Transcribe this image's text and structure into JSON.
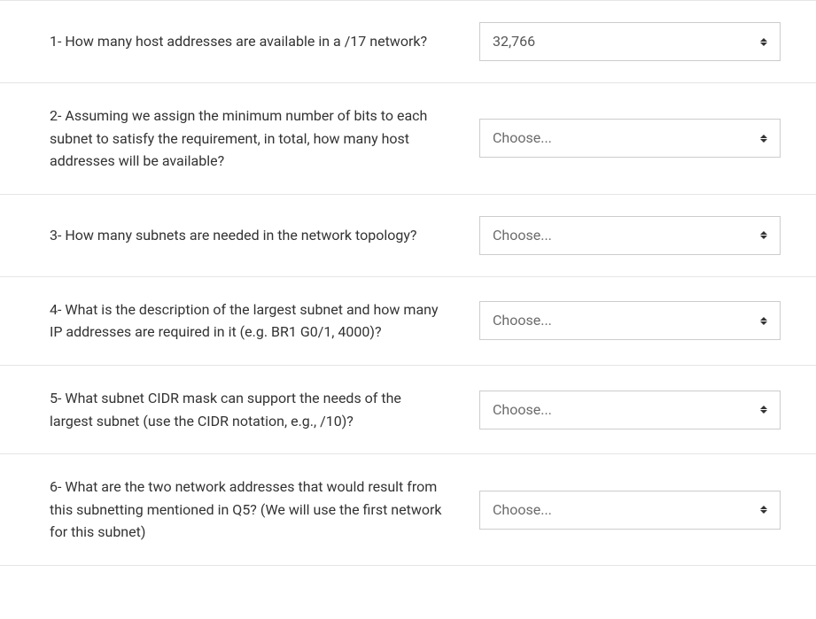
{
  "questions": [
    {
      "text": "1- How many host addresses are available in a /17 network?",
      "selected": "32,766",
      "isPlaceholder": false
    },
    {
      "text": "2- Assuming we assign the minimum number of bits to each subnet to satisfy the requirement, in total, how many host addresses will be available?",
      "selected": "Choose...",
      "isPlaceholder": true
    },
    {
      "text": "3- How many subnets are needed in the network topology?",
      "selected": "Choose...",
      "isPlaceholder": true
    },
    {
      "text": "4- What is the description of the largest subnet and how many IP addresses are required in it (e.g. BR1 G0/1, 4000)?",
      "selected": "Choose...",
      "isPlaceholder": true
    },
    {
      "text": "5- What subnet CIDR mask can support the needs of the largest subnet (use the CIDR notation, e.g., /10)?",
      "selected": "Choose...",
      "isPlaceholder": true
    },
    {
      "text": "6- What are the two network addresses that would result from this subnetting mentioned in Q5? (We will use the first network for this subnet)",
      "selected": "Choose...",
      "isPlaceholder": true
    }
  ]
}
